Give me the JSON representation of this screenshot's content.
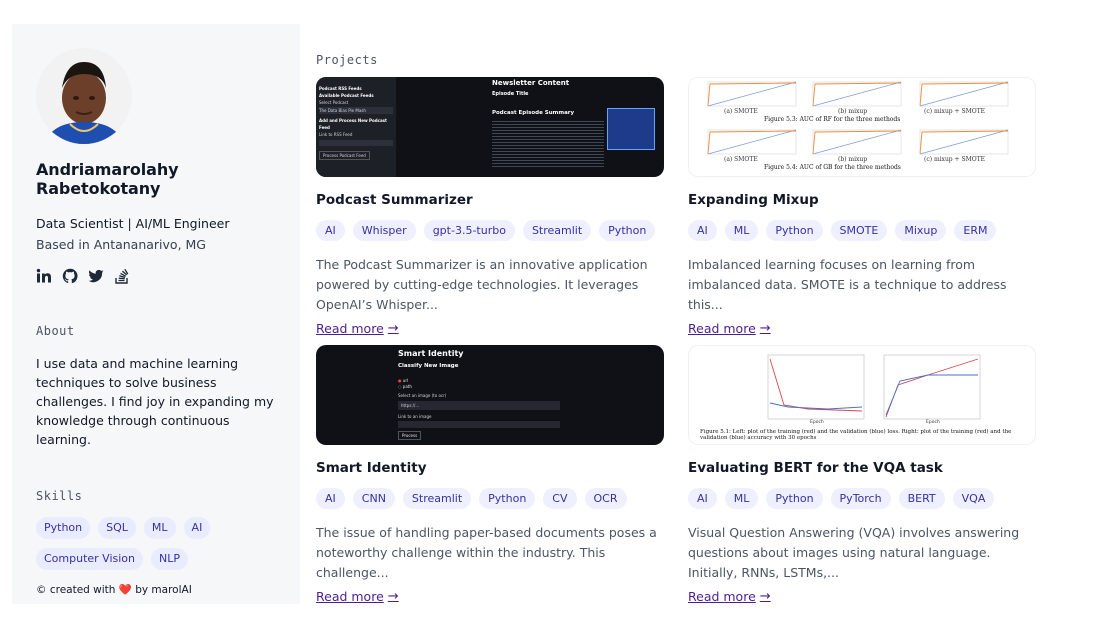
{
  "profile": {
    "name": "Andriamarolahy Rabetokotany",
    "role": "Data Scientist | AI/ML Engineer",
    "location": "Based in Antananarivo, MG",
    "social_icons": [
      "linkedin-icon",
      "github-icon",
      "twitter-icon",
      "stackoverflow-icon"
    ]
  },
  "about": {
    "title": "About",
    "text": "I use data and machine learning techniques to solve business challenges. I find joy in expanding my knowledge through continuous learning."
  },
  "skills": {
    "title": "Skills",
    "items": [
      "Python",
      "SQL",
      "ML",
      "AI",
      "Computer Vision",
      "NLP"
    ]
  },
  "footer": {
    "prefix": "© created with",
    "heart": "❤️",
    "suffix": "by marolAI"
  },
  "projects": {
    "title": "Projects",
    "read_more": "Read more",
    "items": [
      {
        "title": "Podcast Summarizer",
        "tags": [
          "AI",
          "Whisper",
          "gpt-3.5-turbo",
          "Streamlit",
          "Python"
        ],
        "description": "The Podcast Summarizer is an innovative application powered by cutting-edge technologies. It leverages OpenAI’s Whisper...",
        "thumb": {
          "side_title": "Podcast RSS Feeds",
          "side_sub": "Available Podcast Feeds",
          "side_label": "Select Podcast",
          "side_select": "The Data Bias Pie Mash",
          "side_add": "Add and Process New Podcast Feed",
          "side_rss": "Link to RSS Feed",
          "side_btn": "Process Podcast Feed",
          "main_title": "Newsletter Content",
          "episode": "Episode Title",
          "summary": "Podcast Episode Summary"
        }
      },
      {
        "title": "Expanding Mixup",
        "tags": [
          "AI",
          "ML",
          "Python",
          "SMOTE",
          "Mixup",
          "ERM"
        ],
        "description": "Imbalanced learning focuses on learning from imbalanced data. SMOTE is a technique to address this...",
        "thumb": {
          "labels_top": [
            "(a) SMOTE",
            "(b) mixup",
            "(c) mixup + SMOTE"
          ],
          "caption_top": "Figure 5.3: AUC of RF for the three methods",
          "labels_bottom": [
            "(a) SMOTE",
            "(b) mixup",
            "(c) mixup + SMOTE"
          ],
          "caption_bottom": "Figure 5.4: AUC of GB for the three methods"
        }
      },
      {
        "title": "Smart Identity",
        "tags": [
          "AI",
          "CNN",
          "Streamlit",
          "Python",
          "CV",
          "OCR"
        ],
        "description": "The issue of handling paper-based documents poses a noteworthy challenge within the industry. This challenge...",
        "thumb": {
          "app_title": "Smart Identity",
          "section": "Classify New Image",
          "radio_a": "url",
          "radio_b": "path",
          "input_label": "Select an image (to ocr)",
          "input_value": "https://...",
          "link_label": "Link to an image",
          "button": "Process"
        }
      },
      {
        "title": "Evaluating BERT for the VQA task",
        "tags": [
          "AI",
          "ML",
          "Python",
          "PyTorch",
          "BERT",
          "VQA"
        ],
        "description": "Visual Question Answering (VQA) involves answering questions about images using natural language. Initially, RNNs, LSTMs,...",
        "thumb": {
          "xlabel_left": "Epoch",
          "xlabel_right": "Epoch",
          "caption": "Figure 5.1: Left: plot of the training (red) and the validation (blue) loss. Right: plot of the training (red) and the validation (blue) accuracy with 30 epochs"
        }
      }
    ]
  }
}
